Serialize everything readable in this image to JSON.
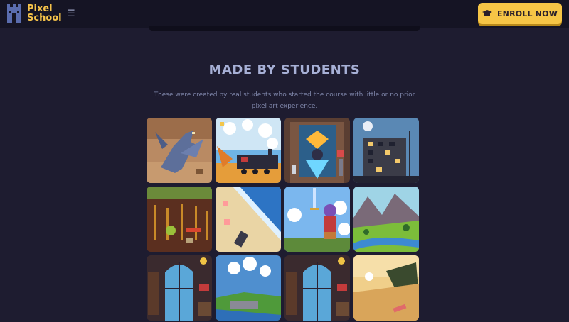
{
  "header": {
    "brand_line1": "Pixel",
    "brand_line2": "School",
    "menu_icon": "hamburger-icon",
    "logo_icon": "castle-icon",
    "enroll_label": "ENROLL NOW",
    "enroll_icon": "graduation-cap-icon",
    "accent_color": "#f6c546"
  },
  "main": {
    "title": "MADE BY STUDENTS",
    "description": "These were created by real students who started the course with little or no prior pixel art experience."
  },
  "gallery": {
    "items": [
      {
        "subject": "dragon"
      },
      {
        "subject": "steam-train"
      },
      {
        "subject": "glowing-hall"
      },
      {
        "subject": "city-building-night"
      },
      {
        "subject": "farm-field"
      },
      {
        "subject": "beach-shore"
      },
      {
        "subject": "hero-with-sword"
      },
      {
        "subject": "mountain-valley"
      },
      {
        "subject": "stained-glass-room"
      },
      {
        "subject": "coastal-cliff"
      },
      {
        "subject": "stained-glass-room"
      },
      {
        "subject": "desert-beach"
      }
    ]
  }
}
